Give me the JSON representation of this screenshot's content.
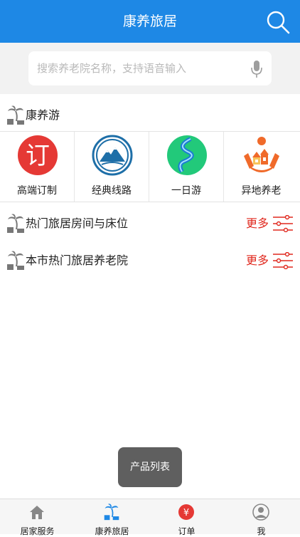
{
  "header": {
    "title": "康养旅居",
    "icon": "search-icon",
    "color": "#1e88e5"
  },
  "search": {
    "placeholder": "搜索养老院名称，支持语音输入",
    "icon": "microphone-icon"
  },
  "section_travel": {
    "label": "康养游",
    "icon": "palm-tree-icon"
  },
  "categories": [
    {
      "label": "高端订制",
      "icon": "ding-character-icon",
      "color": "#e53935"
    },
    {
      "label": "经典线路",
      "icon": "mountain-icon",
      "color": "#1e6fa8"
    },
    {
      "label": "一日游",
      "icon": "river-road-icon",
      "color": "#22c97a"
    },
    {
      "label": "异地养老",
      "icon": "hands-houses-icon",
      "color": "#f06a2a"
    }
  ],
  "section_rooms": {
    "label": "热门旅居房间与床位",
    "more": "更多"
  },
  "section_homes": {
    "label": "本市热门旅居养老院",
    "more": "更多"
  },
  "toast": {
    "text": "产品列表"
  },
  "tabbar": [
    {
      "label": "居家服务",
      "icon": "home-icon"
    },
    {
      "label": "康养旅居",
      "icon": "palm-tree-icon"
    },
    {
      "label": "订单",
      "icon": "yen-bag-icon"
    },
    {
      "label": "我",
      "icon": "user-icon"
    }
  ]
}
